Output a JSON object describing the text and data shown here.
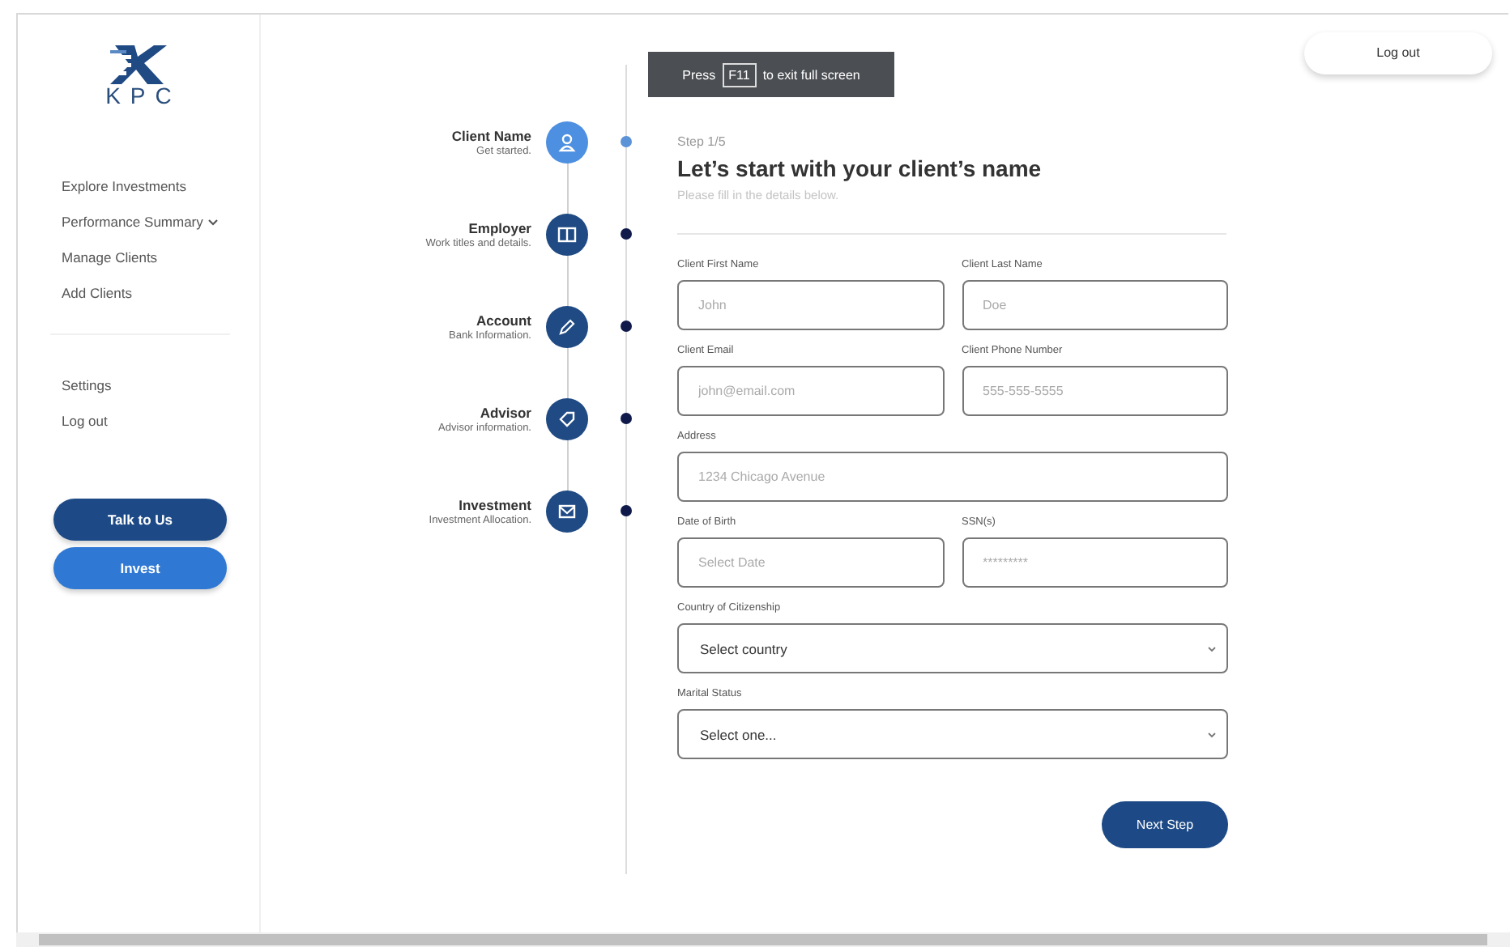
{
  "sidebar": {
    "logo": "KPC",
    "nav": [
      {
        "label": "Explore Investments",
        "expandable": false
      },
      {
        "label": "Performance Summary",
        "expandable": true
      },
      {
        "label": "Manage Clients",
        "expandable": false
      },
      {
        "label": "Add Clients",
        "expandable": false
      }
    ],
    "secondary_nav": [
      {
        "label": "Settings"
      },
      {
        "label": "Log out"
      }
    ],
    "buttons": [
      {
        "label": "Talk to Us",
        "kind": "dark"
      },
      {
        "label": "Invest",
        "kind": "bright"
      }
    ]
  },
  "fullscreen_notice": {
    "before": "Press",
    "key": "F11",
    "after": "to exit full screen"
  },
  "steps": [
    {
      "title": "Client Name",
      "subtitle": "Get started.",
      "selected": true
    },
    {
      "title": "Employer",
      "subtitle": "Work titles and details.",
      "selected": false
    },
    {
      "title": "Account",
      "subtitle": "Bank Information.",
      "selected": false
    },
    {
      "title": "Advisor",
      "subtitle": "Advisor information.",
      "selected": false
    },
    {
      "title": "Investment",
      "subtitle": "Investment Allocation.",
      "selected": false
    }
  ],
  "form": {
    "step": "Step 1/5",
    "title": "Let’s start with your client’s name",
    "subtitle": "Please fill in the details below.",
    "rows": [
      [
        {
          "label": "Client First Name",
          "kind": "text",
          "placeholder": "John"
        },
        {
          "label": "Client Last Name",
          "kind": "text",
          "placeholder": "Doe"
        }
      ],
      [
        {
          "label": "Client Email",
          "kind": "text",
          "placeholder": "john@email.com"
        },
        {
          "label": "Client Phone Number",
          "kind": "text",
          "placeholder": "555-555-5555"
        }
      ],
      [
        {
          "label": "Address",
          "kind": "text",
          "placeholder": "1234 Chicago Avenue"
        }
      ],
      [
        {
          "label": "Date of Birth",
          "kind": "text",
          "placeholder": "Select Date"
        },
        {
          "label": "SSN(s)",
          "kind": "text",
          "placeholder": "*********"
        }
      ],
      [
        {
          "label": "Country of Citizenship",
          "kind": "select",
          "value": "Select country"
        }
      ],
      [
        {
          "label": "Marital Status",
          "kind": "select",
          "value": "Select one..."
        }
      ]
    ],
    "next_button": "Next Step"
  },
  "header": {
    "logout_button": "Log out"
  }
}
